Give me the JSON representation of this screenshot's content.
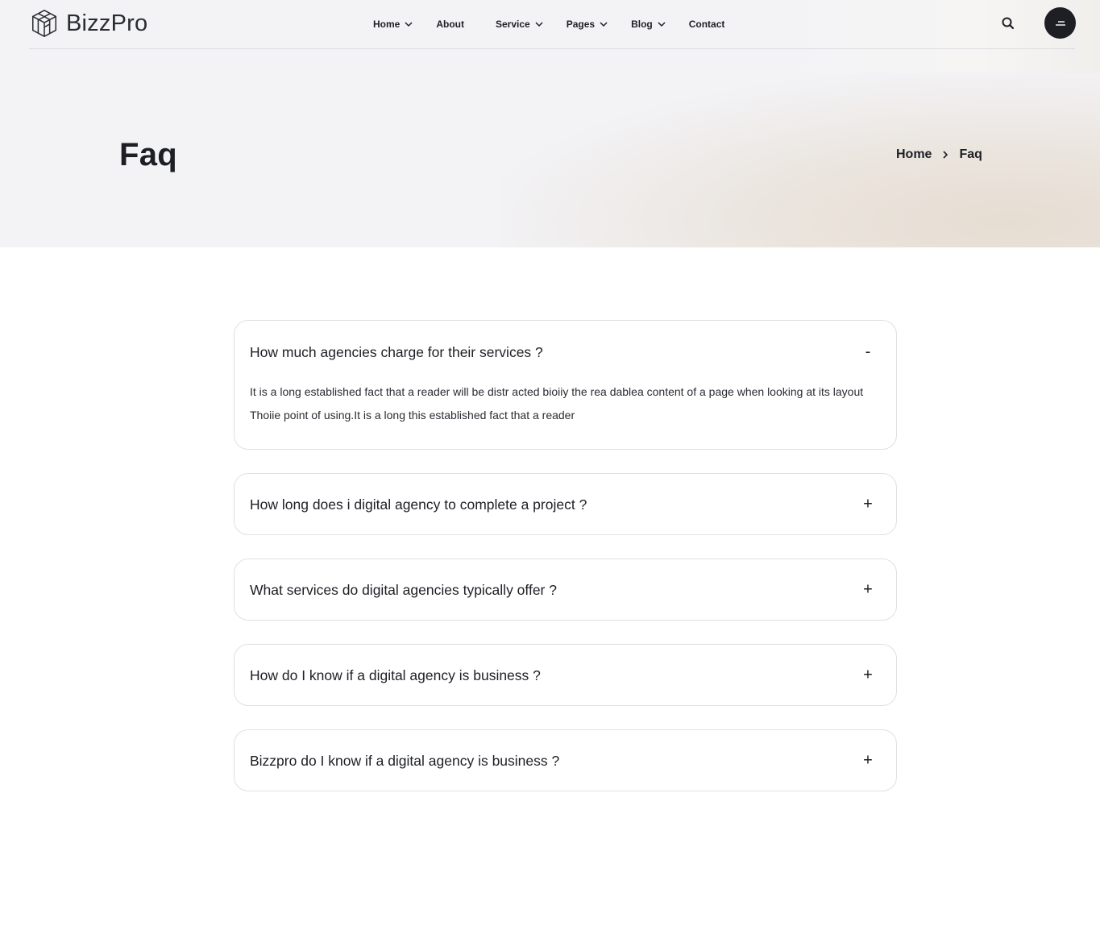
{
  "brand": {
    "name": "BizzPro"
  },
  "nav": {
    "items": [
      {
        "label": "Home",
        "has_dropdown": true
      },
      {
        "label": "About",
        "has_dropdown": false
      },
      {
        "label": "Service",
        "has_dropdown": true
      },
      {
        "label": "Pages",
        "has_dropdown": true
      },
      {
        "label": "Blog",
        "has_dropdown": true
      },
      {
        "label": "Contact",
        "has_dropdown": false
      }
    ]
  },
  "header": {
    "search_icon": "search-icon",
    "menu_icon": "hamburger-menu-icon"
  },
  "hero": {
    "title": "Faq",
    "breadcrumb": [
      "Home",
      "Faq"
    ]
  },
  "faq": {
    "items": [
      {
        "question": "How much agencies charge for their services ?",
        "answer": "It is a long established fact that a reader will be distr acted bioiiy the rea dablea content of a page when looking at its layout Thoiie point of using.It is a long this established fact that a reader",
        "expanded": true,
        "toggle": "-"
      },
      {
        "question": "How long does i digital agency to complete a project ?",
        "expanded": false,
        "toggle": "+"
      },
      {
        "question": "What services do digital agencies typically offer ?",
        "expanded": false,
        "toggle": "+"
      },
      {
        "question": "How do I know if a digital agency is business ?",
        "expanded": false,
        "toggle": "+"
      },
      {
        "question": "Bizzpro do I know if a digital agency is business ?",
        "expanded": false,
        "toggle": "+"
      }
    ]
  },
  "colors": {
    "text": "#1d1f25",
    "hero_bg": "#f3f3f6",
    "border": "#dfe0e4",
    "accent_dark": "#1d1f25"
  }
}
